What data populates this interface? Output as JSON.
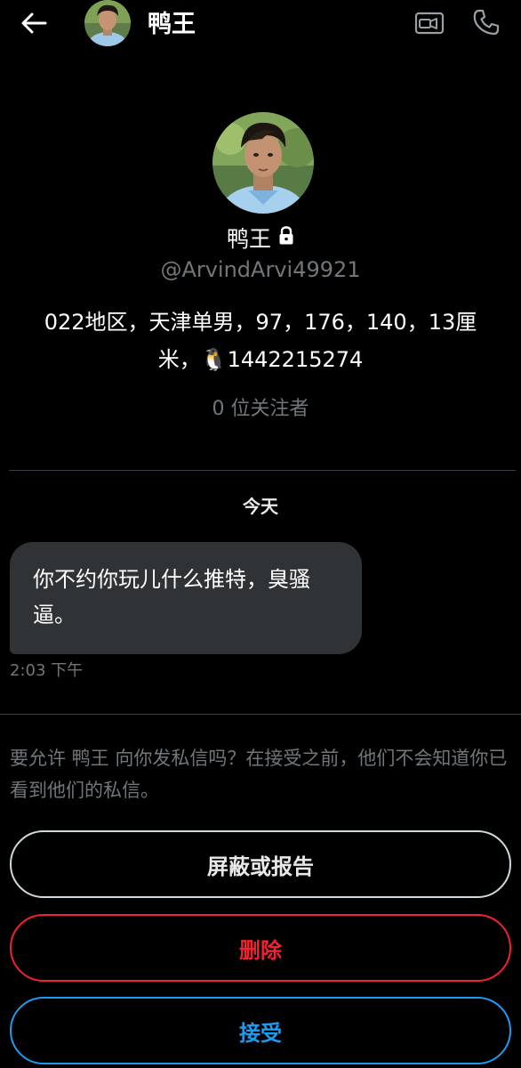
{
  "header": {
    "name": "鸭王"
  },
  "profile": {
    "name": "鸭王",
    "handle": "@ArvindArvi49921",
    "bio_line1": "022地区，天津单男，97，176，140，13厘",
    "bio_line2_prefix": "米，",
    "bio_emoji": "🐧",
    "bio_line2_suffix": "1442215274",
    "followers": "0 位关注者",
    "protected_icon": "lock-icon"
  },
  "conversation": {
    "date_label": "今天",
    "message_line1": "你不约你玩儿什么推特，臭骚",
    "message_line2": "逼。",
    "timestamp": "2:03 下午"
  },
  "request": {
    "prompt": "要允许 鸭王 向你发私信吗？在接受之前，他们不会知道你已看到他们的私信。",
    "block_label": "屏蔽或报告",
    "delete_label": "删除",
    "accept_label": "接受"
  },
  "colors": {
    "background": "#000000",
    "secondary_text": "#71767b",
    "bubble": "#2f3336",
    "danger": "#f4212e",
    "accent": "#1d9bf0"
  },
  "icons": {
    "back": "arrow-left-icon",
    "video": "video-camera-icon",
    "call": "phone-icon"
  }
}
